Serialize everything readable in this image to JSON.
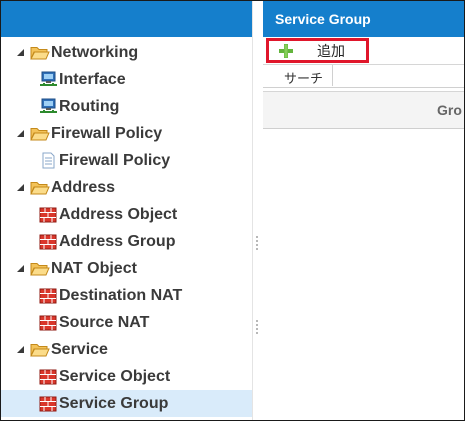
{
  "colors": {
    "header_blue": "#157fcc",
    "selected_row": "#d9ebfa",
    "highlight_red": "#e0162b",
    "add_green": "#63b43c"
  },
  "tree": {
    "items": [
      {
        "label": "Networking",
        "icon": "folder-open-icon",
        "level": 0,
        "expanded": true
      },
      {
        "label": "Interface",
        "icon": "network-computer-icon",
        "level": 1
      },
      {
        "label": "Routing",
        "icon": "network-computer-icon",
        "level": 1
      },
      {
        "label": "Firewall Policy",
        "icon": "folder-open-icon",
        "level": 0,
        "expanded": true
      },
      {
        "label": "Firewall Policy",
        "icon": "document-icon",
        "level": 1
      },
      {
        "label": "Address",
        "icon": "folder-open-icon",
        "level": 0,
        "expanded": true
      },
      {
        "label": "Address Object",
        "icon": "firewall-brick-icon",
        "level": 1
      },
      {
        "label": "Address Group",
        "icon": "firewall-brick-icon",
        "level": 1
      },
      {
        "label": "NAT Object",
        "icon": "folder-open-icon",
        "level": 0,
        "expanded": true
      },
      {
        "label": "Destination NAT",
        "icon": "firewall-brick-icon",
        "level": 1
      },
      {
        "label": "Source NAT",
        "icon": "firewall-brick-icon",
        "level": 1
      },
      {
        "label": "Service",
        "icon": "folder-open-icon",
        "level": 0,
        "expanded": true
      },
      {
        "label": "Service Object",
        "icon": "firewall-brick-icon",
        "level": 1
      },
      {
        "label": "Service Group",
        "icon": "firewall-brick-icon",
        "level": 1,
        "selected": true
      }
    ]
  },
  "panel": {
    "title": "Service Group",
    "add_label": "追加",
    "search_label": "サーチ",
    "search_value": "",
    "column_group": "Gro"
  }
}
